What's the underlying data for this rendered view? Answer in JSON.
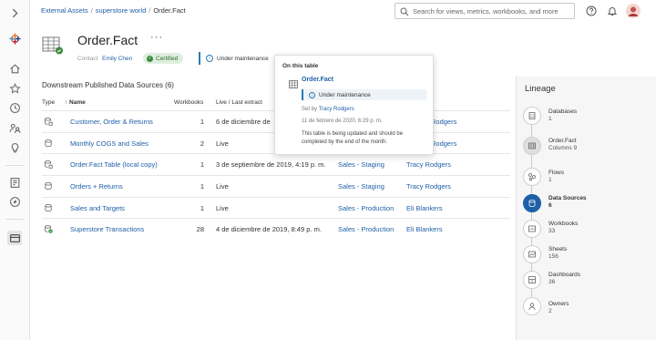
{
  "breadcrumb": {
    "items": [
      "External Assets",
      "superstore world",
      "Order.Fact"
    ]
  },
  "search": {
    "placeholder": "Search for views, metrics, workbooks, and more"
  },
  "asset": {
    "title": "Order.Fact",
    "more_glyph": "···",
    "contact_label": "Contact",
    "contact_name": "Emily Chen",
    "certified_label": "Certified",
    "maintenance_label": "Under maintenance"
  },
  "downstream": {
    "title": "Downstream Published Data Sources (6)",
    "columns": [
      "Type",
      "↑ Name",
      "Workbooks",
      "Live / Last extract",
      "Project",
      "Owner"
    ],
    "rows": [
      {
        "icon": "datasource-extract-icon",
        "name": "Customer, Order & Returns",
        "workbooks": "1",
        "live": "6 de diciembre de",
        "project": "",
        "owner": "Rodgers"
      },
      {
        "icon": "datasource-live-icon",
        "name": "Monthly COGS and Sales",
        "workbooks": "2",
        "live": "Live",
        "project": "",
        "owner": "Rodgers"
      },
      {
        "icon": "datasource-extract-icon",
        "name": "Order.Fact Table (local copy)",
        "workbooks": "1",
        "live": "3 de septiembre de 2019, 4:19 p. m.",
        "project": "Sales - Staging",
        "owner": "Tracy Rodgers"
      },
      {
        "icon": "datasource-live-icon",
        "name": "Orders + Returns",
        "workbooks": "1",
        "live": "Live",
        "project": "Sales - Staging",
        "owner": "Tracy Rodgers"
      },
      {
        "icon": "datasource-live-icon",
        "name": "Sales and Targets",
        "workbooks": "1",
        "live": "Live",
        "project": "Sales - Production",
        "owner": "Eli Blankers"
      },
      {
        "icon": "datasource-certified-extract-icon",
        "name": "Superstore Transactions",
        "workbooks": "28",
        "live": "4 de diciembre de 2019, 8:49 p. m.",
        "project": "Sales - Production",
        "owner": "Eli Blankers"
      }
    ]
  },
  "popup": {
    "header": "On this table",
    "table_name": "Order.Fact",
    "maintenance_label": "Under maintenance",
    "set_by_label": "Set by",
    "set_by_name": "Tracy Rodgers",
    "timestamp": "11 de febrero de 2020, 6:29 p. m.",
    "message": "This table is being updated and should be completed by the end of the month."
  },
  "lineage": {
    "title": "Lineage",
    "nodes": [
      {
        "label": "Databases",
        "count": "1",
        "icon": "database-icon"
      },
      {
        "label": "Order.Fact",
        "count": "Columns 9",
        "icon": "table-icon"
      },
      {
        "label": "Flows",
        "count": "1",
        "icon": "flow-icon"
      },
      {
        "label": "Data Sources",
        "count": "6",
        "icon": "datasource-icon"
      },
      {
        "label": "Workbooks",
        "count": "33",
        "icon": "workbook-icon"
      },
      {
        "label": "Sheets",
        "count": "156",
        "icon": "sheet-icon"
      },
      {
        "label": "Dashboards",
        "count": "36",
        "icon": "dashboard-icon"
      },
      {
        "label": "Owners",
        "count": "2",
        "icon": "owner-icon"
      }
    ]
  },
  "colors": {
    "link": "#1f5fa8",
    "accent": "#2a7ab5",
    "certified": "#3b8a3b"
  }
}
